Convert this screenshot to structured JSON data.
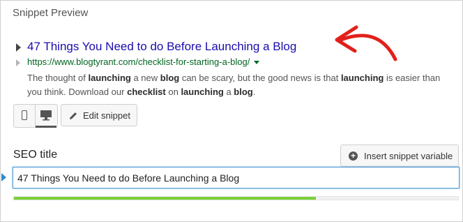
{
  "panel": {
    "section_title": "Snippet Preview"
  },
  "snippet": {
    "title": "47 Things You Need to do Before Launching a Blog",
    "url": "https://www.blogtyrant.com/checklist-for-starting-a-blog/",
    "description_segments": [
      {
        "text": "The thought of ",
        "bold": false
      },
      {
        "text": "launching",
        "bold": true
      },
      {
        "text": " a new ",
        "bold": false
      },
      {
        "text": "blog",
        "bold": true
      },
      {
        "text": " can be scary, but the good news is that ",
        "bold": false
      },
      {
        "text": "launching",
        "bold": true
      },
      {
        "text": " is easier than you think. Download our ",
        "bold": false
      },
      {
        "text": "checklist",
        "bold": true
      },
      {
        "text": " on ",
        "bold": false
      },
      {
        "text": "launching",
        "bold": true
      },
      {
        "text": " a ",
        "bold": false
      },
      {
        "text": "blog",
        "bold": true
      },
      {
        "text": ".",
        "bold": false
      }
    ],
    "title_color": "#1a0dab",
    "url_color": "#006621"
  },
  "toolbar": {
    "active_device": "desktop",
    "edit_snippet_label": "Edit snippet"
  },
  "seo": {
    "label": "SEO title",
    "insert_variable_label": "Insert snippet variable",
    "title_value": "47 Things You Need to do Before Launching a Blog",
    "progress_fraction": 0.68,
    "progress_color": "#7ad03a"
  },
  "icons": {
    "mobile": "mobile-phone-icon",
    "desktop": "desktop-monitor-icon",
    "edit": "pencil-icon",
    "insert": "plus-circle-icon",
    "annotation": "red-arrow-annotation"
  }
}
